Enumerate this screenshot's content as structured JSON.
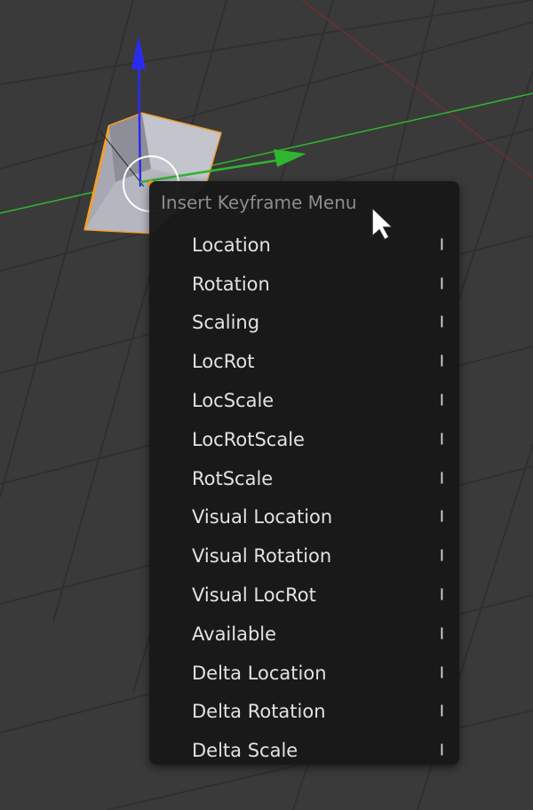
{
  "colors": {
    "viewport_bg": "#3a3a3a",
    "grid_line": "#303030",
    "x_axis": "#cc3333",
    "y_axis": "#2fb52f",
    "z_axis": "#2b2bf0",
    "selection_outline": "#f0a030",
    "menu_bg": "#181818",
    "menu_title": "#8c8c8c",
    "menu_text": "#e2e2e2"
  },
  "menu": {
    "title": "Insert Keyframe Menu",
    "items": [
      {
        "label": "Location",
        "shortcut": "I"
      },
      {
        "label": "Rotation",
        "shortcut": "I"
      },
      {
        "label": "Scaling",
        "shortcut": "I"
      },
      {
        "label": "LocRot",
        "shortcut": "I"
      },
      {
        "label": "LocScale",
        "shortcut": "I"
      },
      {
        "label": "LocRotScale",
        "shortcut": "I"
      },
      {
        "label": "RotScale",
        "shortcut": "I"
      },
      {
        "label": "Visual Location",
        "shortcut": "I"
      },
      {
        "label": "Visual Rotation",
        "shortcut": "I"
      },
      {
        "label": "Visual LocRot",
        "shortcut": "I"
      },
      {
        "label": "Available",
        "shortcut": "I"
      },
      {
        "label": "Delta Location",
        "shortcut": "I"
      },
      {
        "label": "Delta Rotation",
        "shortcut": "I"
      },
      {
        "label": "Delta Scale",
        "shortcut": "I"
      }
    ]
  }
}
